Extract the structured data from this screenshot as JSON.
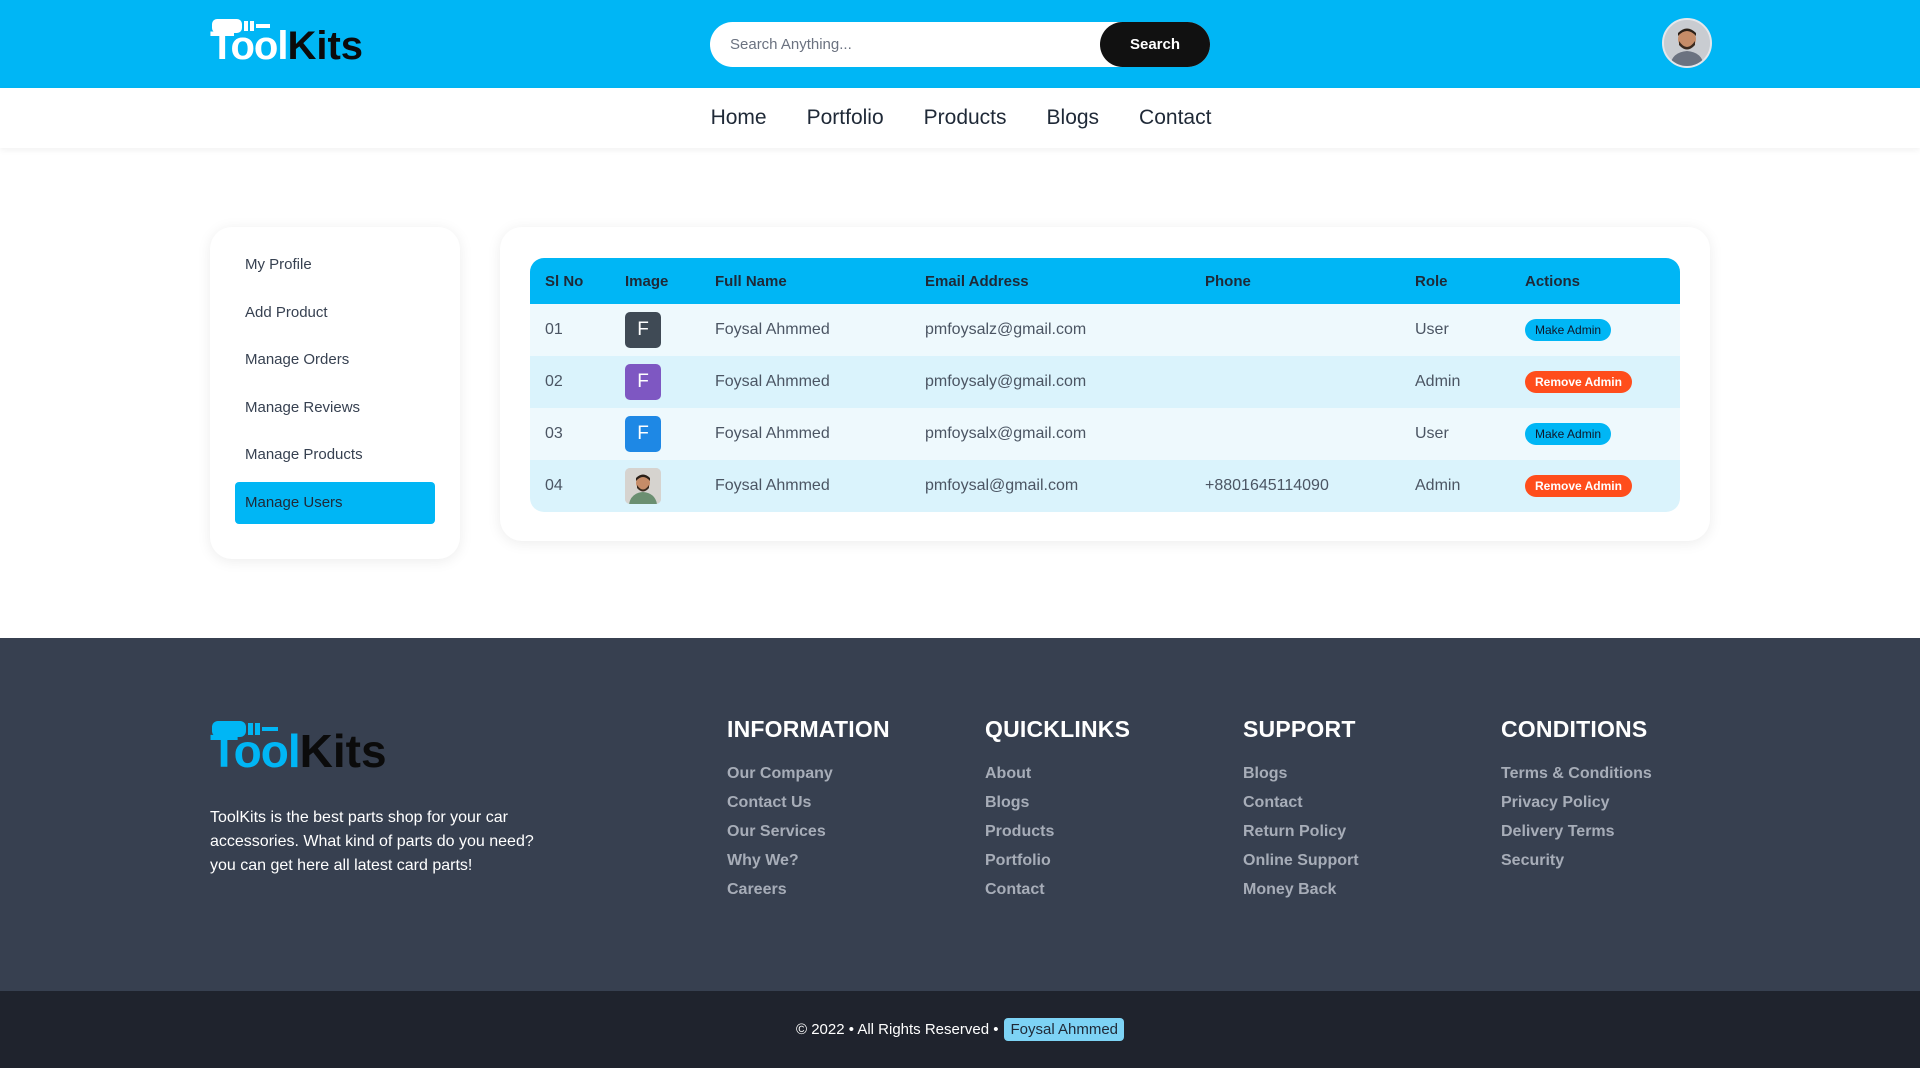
{
  "brand": {
    "part1": "Tool",
    "part2": "Kits",
    "color_accent": "#00b6f5"
  },
  "search": {
    "placeholder": "Search Anything...",
    "button_label": "Search"
  },
  "user": {
    "avatar_icon": "user-avatar"
  },
  "nav": {
    "items": [
      "Home",
      "Portfolio",
      "Products",
      "Blogs",
      "Contact"
    ]
  },
  "sidebar": {
    "items": [
      {
        "label": "My Profile"
      },
      {
        "label": "Add Product"
      },
      {
        "label": "Manage Orders"
      },
      {
        "label": "Manage Reviews"
      },
      {
        "label": "Manage Products"
      },
      {
        "label": "Manage Users",
        "active": true
      }
    ]
  },
  "users_table": {
    "columns": [
      "Sl No",
      "Image",
      "Full Name",
      "Email Address",
      "Phone",
      "Role",
      "Actions"
    ],
    "rows": [
      {
        "sl": "01",
        "initial": "F",
        "avatar_color": "#3f4a55",
        "name": "Foysal Ahmmed",
        "email": "pmfoysalz@gmail.com",
        "phone": "",
        "role": "User",
        "action": "Make Admin"
      },
      {
        "sl": "02",
        "initial": "F",
        "avatar_color": "#7e57c2",
        "name": "Foysal Ahmmed",
        "email": "pmfoysaly@gmail.com",
        "phone": "",
        "role": "Admin",
        "action": "Remove Admin"
      },
      {
        "sl": "03",
        "initial": "F",
        "avatar_color": "#1e88e5",
        "name": "Foysal Ahmmed",
        "email": "pmfoysalx@gmail.com",
        "phone": "",
        "role": "User",
        "action": "Make Admin"
      },
      {
        "sl": "04",
        "initial": "",
        "avatar_color": "",
        "name": "Foysal Ahmmed",
        "email": "pmfoysal@gmail.com",
        "phone": "+8801645114090",
        "role": "Admin",
        "action": "Remove Admin"
      }
    ]
  },
  "footer": {
    "description": "ToolKits is the best parts shop for your car accessories. What kind of parts do you need? you can get here all latest card parts!",
    "columns": [
      {
        "title": "INFORMATION",
        "links": [
          "Our Company",
          "Contact Us",
          "Our Services",
          "Why We?",
          "Careers"
        ]
      },
      {
        "title": "QUICKLINKS",
        "links": [
          "About",
          "Blogs",
          "Products",
          "Portfolio",
          "Contact"
        ]
      },
      {
        "title": "SUPPORT",
        "links": [
          "Blogs",
          "Contact",
          "Return Policy",
          "Online Support",
          "Money Back"
        ]
      },
      {
        "title": "CONDITIONS",
        "links": [
          "Terms & Conditions",
          "Privacy Policy",
          "Delivery Terms",
          "Security"
        ]
      }
    ],
    "copyright_text": "© 2022 • All Rights Reserved •",
    "copyright_name": "Foysal Ahmmed"
  }
}
